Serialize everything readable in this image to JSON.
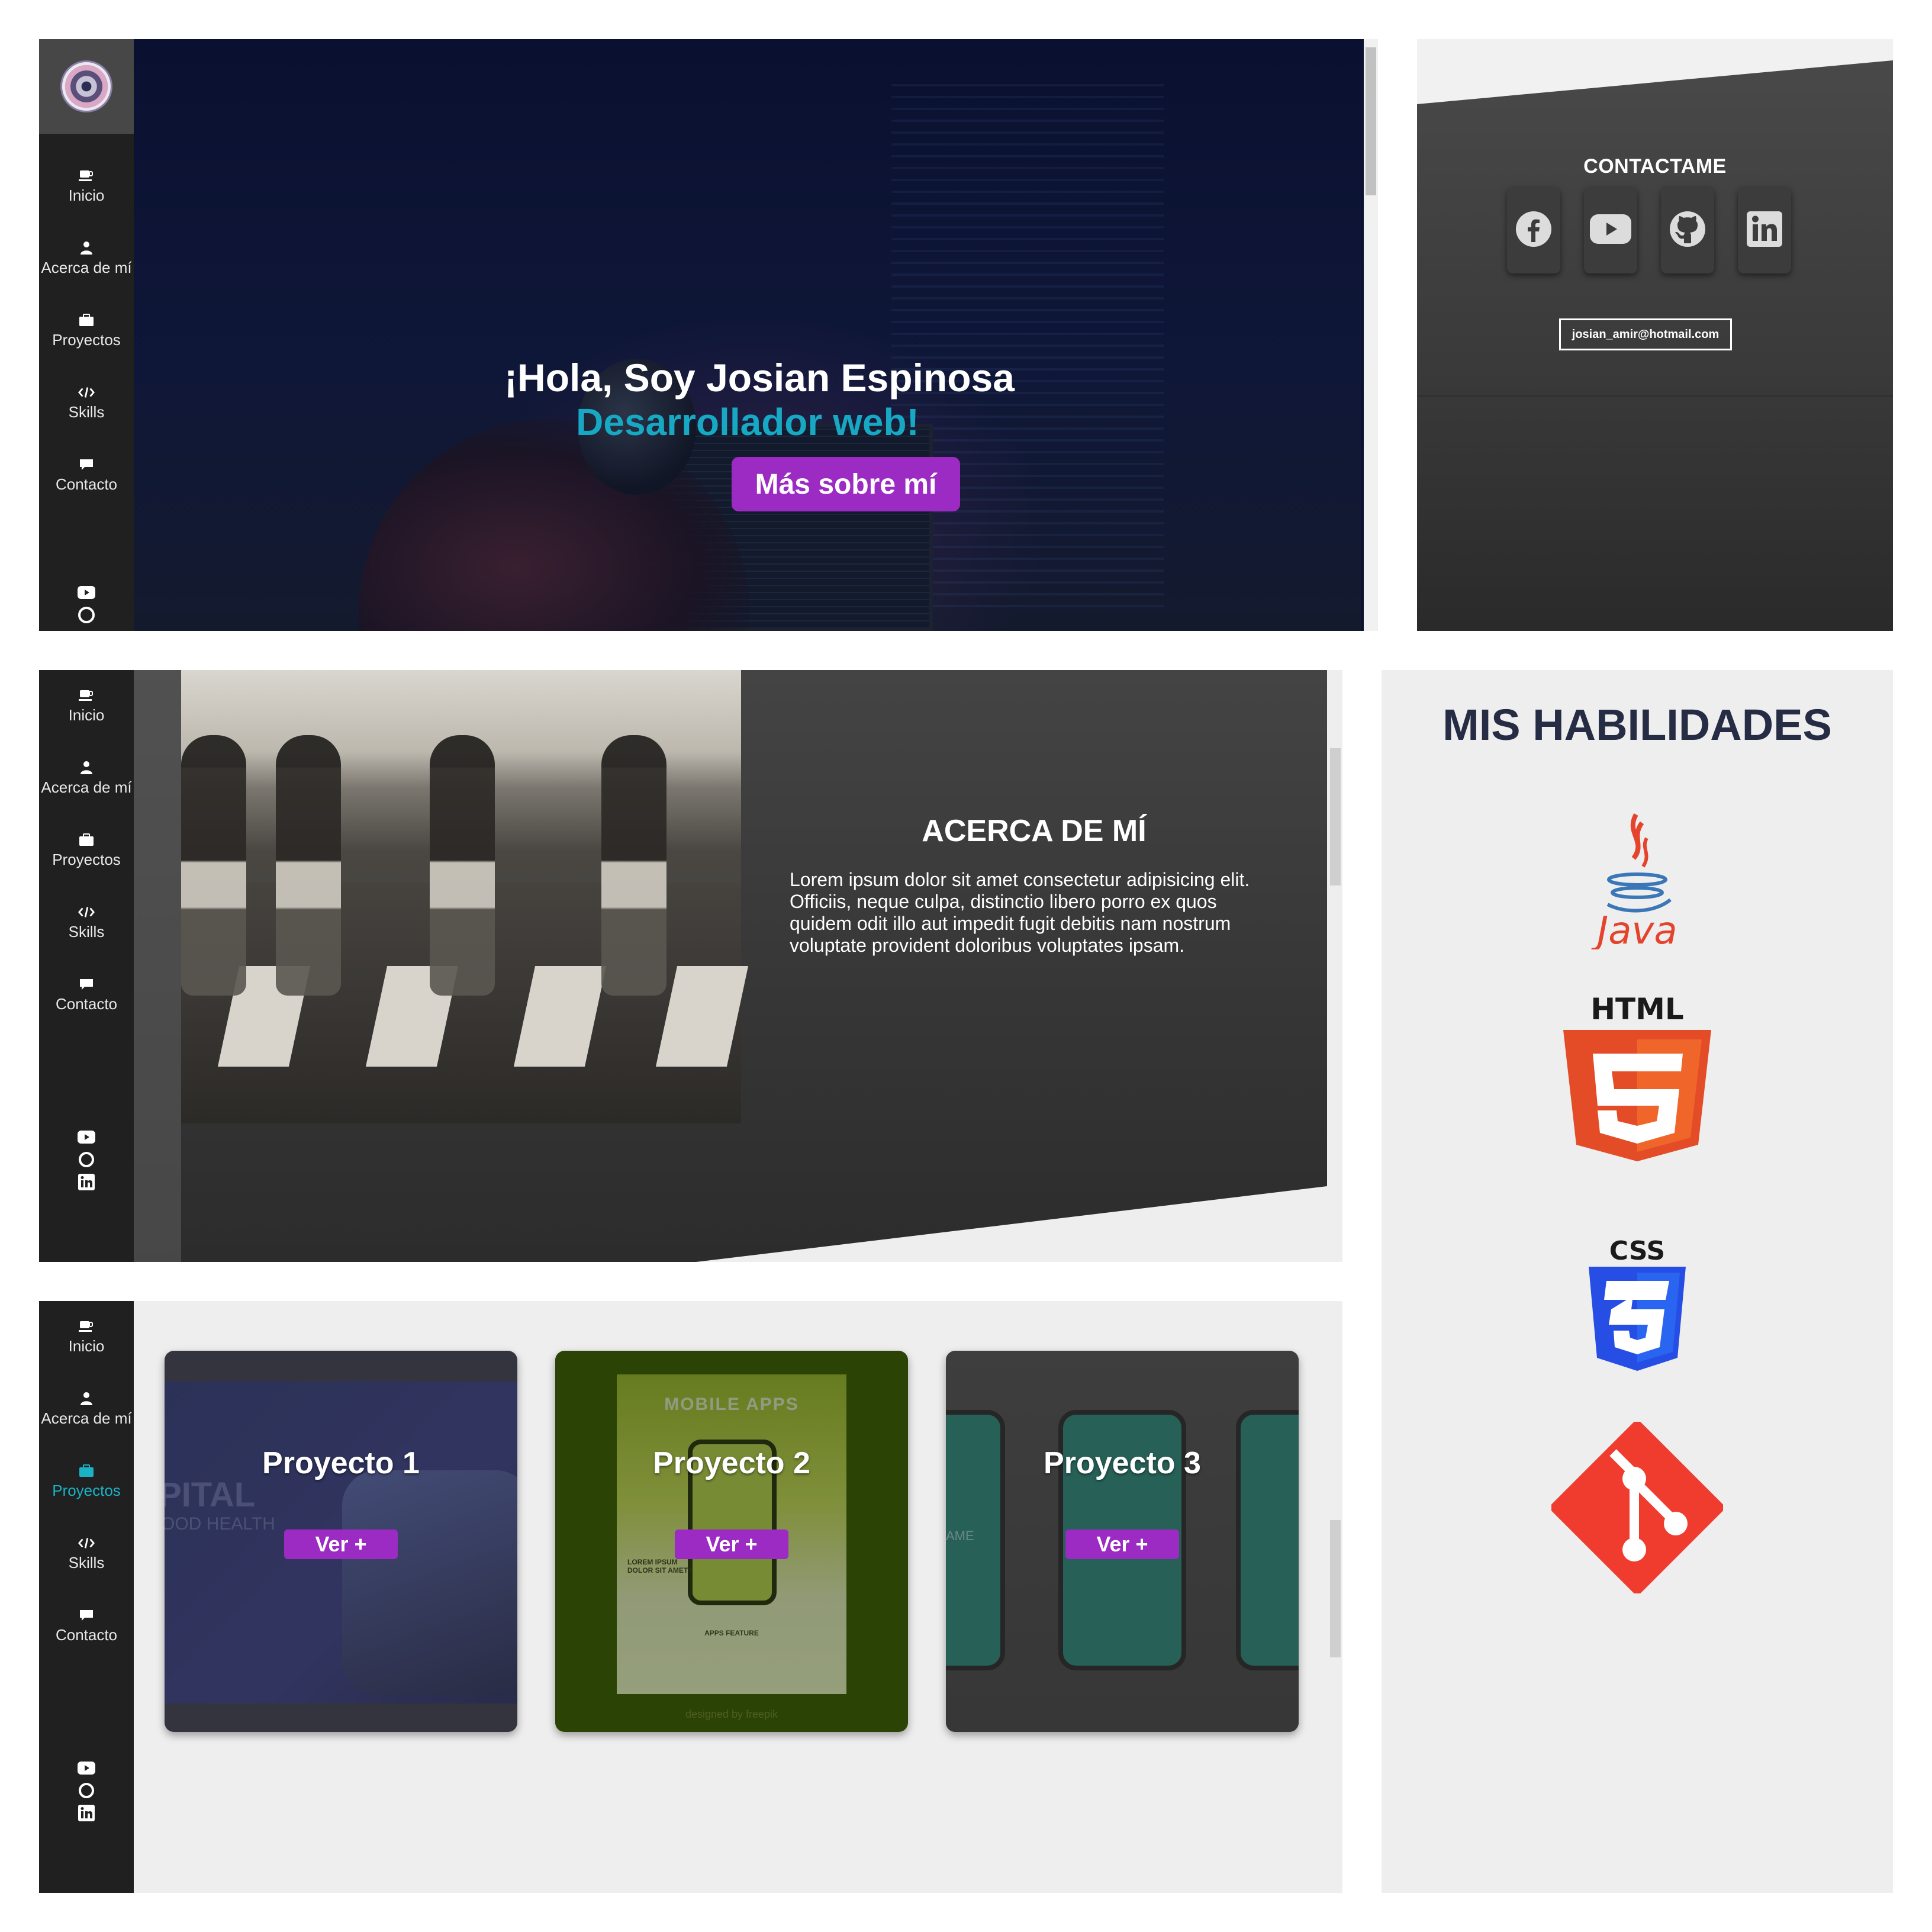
{
  "nav": {
    "items": [
      {
        "label": "Inicio",
        "icon": "coffee-icon"
      },
      {
        "label": "Acerca de mí",
        "icon": "user-icon"
      },
      {
        "label": "Proyectos",
        "icon": "briefcase-icon"
      },
      {
        "label": "Skills",
        "icon": "code-icon"
      },
      {
        "label": "Contacto",
        "icon": "comment-icon"
      }
    ],
    "active_color": "#1ab3c6",
    "social_icons": [
      "youtube-icon",
      "github-icon",
      "linkedin-icon"
    ]
  },
  "hero": {
    "title": "¡Hola, Soy Josian Espinosa",
    "subtitle": "Desarrollador web!",
    "cta_label": "Más sobre mí",
    "accent_color": "#17a8c4",
    "button_color": "#9b2bc2"
  },
  "contact": {
    "title": "CONTACTAME",
    "social": [
      "facebook-icon",
      "youtube-icon",
      "github-icon",
      "linkedin-icon"
    ],
    "email": "josian_amir@hotmail.com"
  },
  "about": {
    "title": "ACERCA DE MÍ",
    "text": "Lorem ipsum dolor sit amet consectetur adipisicing elit. Officiis, neque culpa, distinctio libero porro ex quos quidem odit illo aut impedit fugit debitis nam nostrum voluptate provident doloribus voluptates ipsam."
  },
  "skills": {
    "title": "MIS HABILIDADES",
    "java_label": "Java",
    "html_label": "HTML",
    "css_label": "CSS",
    "logos": [
      "java-logo",
      "html5-logo",
      "css3-logo",
      "git-logo"
    ]
  },
  "projects": {
    "button_label": "Ver +",
    "cards": [
      {
        "title": "Proyecto 1",
        "thumb_text": [
          "PITAL",
          "OOD HEALTH"
        ]
      },
      {
        "title": "Proyecto 2",
        "thumb_text": [
          "MOBILE APPS",
          "LOREM IPSUM DOLOR SIT AMET?",
          "APPS FEATURE",
          "designed by freepik"
        ]
      },
      {
        "title": "Proyecto 3",
        "thumb_text": [
          "AME"
        ]
      }
    ]
  }
}
